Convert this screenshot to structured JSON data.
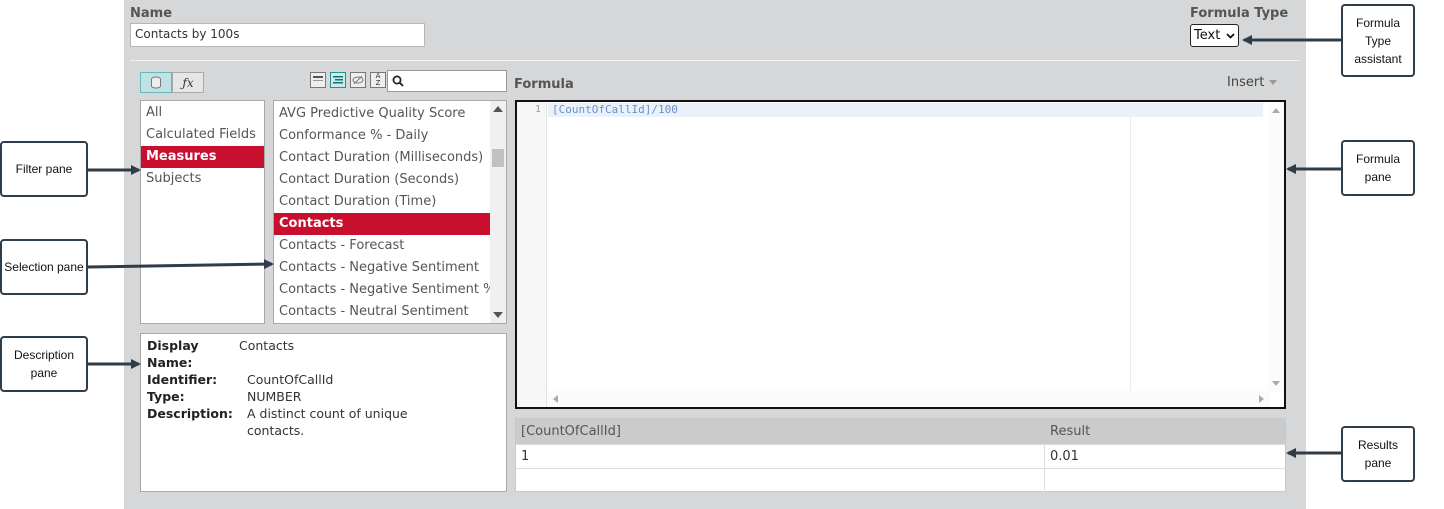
{
  "header": {
    "name_label": "Name",
    "name_value": "Contacts by 100s",
    "formula_type_label": "Formula Type",
    "formula_type_value": "Text"
  },
  "filter_pane": {
    "items": [
      "All",
      "Calculated Fields",
      "Measures",
      "Subjects"
    ],
    "selected": "Measures"
  },
  "selection_pane": {
    "search_value": "",
    "items": [
      "AVG Predictive Quality Score",
      "Conformance % - Daily",
      "Contact Duration (Milliseconds)",
      "Contact Duration (Seconds)",
      "Contact Duration (Time)",
      "Contacts",
      "Contacts - Forecast",
      "Contacts - Negative Sentiment",
      "Contacts - Negative Sentiment %",
      "Contacts - Neutral Sentiment"
    ],
    "selected": "Contacts"
  },
  "description_pane": {
    "display_name_label": "Display Name:",
    "display_name": "Contacts",
    "identifier_label": "Identifier:",
    "identifier": "CountOfCallId",
    "type_label": "Type:",
    "type": "NUMBER",
    "description_label": "Description:",
    "description": "A distinct count of unique contacts."
  },
  "formula": {
    "label": "Formula",
    "insert_label": "Insert",
    "line_number": "1",
    "code": "[CountOfCallId]/100"
  },
  "results": {
    "headers": [
      "[CountOfCallId]",
      "Result"
    ],
    "rows": [
      [
        "1",
        "0.01"
      ],
      [
        "",
        ""
      ]
    ]
  },
  "callouts": {
    "formula_type_assistant": "Formula Type assistant",
    "filter_pane": "Filter pane",
    "selection_pane": "Selection pane",
    "description_pane": "Description pane",
    "formula_pane": "Formula pane",
    "results_pane": "Results pane"
  },
  "colors": {
    "selected_bg": "#c8102e",
    "panel_bg": "#d5d7d8",
    "callout_border": "#2f3d4a"
  }
}
